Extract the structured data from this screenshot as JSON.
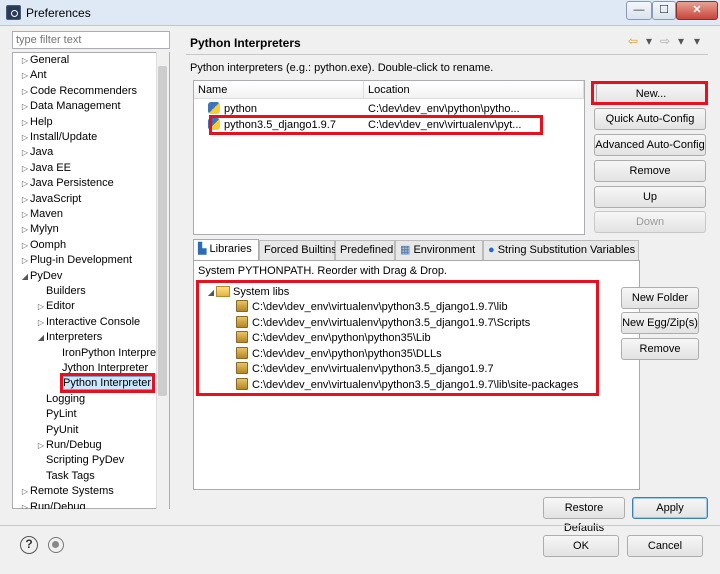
{
  "window": {
    "title": "Preferences",
    "minimize": "—",
    "maximize": "☐",
    "close": "✕"
  },
  "filter": {
    "placeholder": "type filter text"
  },
  "tree": [
    {
      "label": "General",
      "arrow": "▷"
    },
    {
      "label": "Ant",
      "arrow": "▷"
    },
    {
      "label": "Code Recommenders",
      "arrow": "▷"
    },
    {
      "label": "Data Management",
      "arrow": "▷"
    },
    {
      "label": "Help",
      "arrow": "▷"
    },
    {
      "label": "Install/Update",
      "arrow": "▷"
    },
    {
      "label": "Java",
      "arrow": "▷"
    },
    {
      "label": "Java EE",
      "arrow": "▷"
    },
    {
      "label": "Java Persistence",
      "arrow": "▷"
    },
    {
      "label": "JavaScript",
      "arrow": "▷"
    },
    {
      "label": "Maven",
      "arrow": "▷"
    },
    {
      "label": "Mylyn",
      "arrow": "▷"
    },
    {
      "label": "Oomph",
      "arrow": "▷"
    },
    {
      "label": "Plug-in Development",
      "arrow": "▷"
    },
    {
      "label": "PyDev",
      "arrow": "◢"
    },
    {
      "label": "Builders",
      "arrow": ""
    },
    {
      "label": "Editor",
      "arrow": "▷"
    },
    {
      "label": "Interactive Console",
      "arrow": "▷"
    },
    {
      "label": "Interpreters",
      "arrow": "◢"
    },
    {
      "label": "IronPython Interpreter",
      "arrow": ""
    },
    {
      "label": "Jython Interpreter",
      "arrow": ""
    },
    {
      "label": "Python Interpreter",
      "arrow": ""
    },
    {
      "label": "Logging",
      "arrow": ""
    },
    {
      "label": "PyLint",
      "arrow": ""
    },
    {
      "label": "PyUnit",
      "arrow": ""
    },
    {
      "label": "Run/Debug",
      "arrow": "▷"
    },
    {
      "label": "Scripting PyDev",
      "arrow": ""
    },
    {
      "label": "Task Tags",
      "arrow": ""
    },
    {
      "label": "Remote Systems",
      "arrow": "▷"
    },
    {
      "label": "Run/Debug",
      "arrow": "▷"
    }
  ],
  "page": {
    "title": "Python Interpreters",
    "description": "Python interpreters (e.g.: python.exe).   Double-click to rename.",
    "nav": {
      "back": "⇦",
      "back_menu": "▾",
      "forward": "⇨",
      "forward_menu": "▾",
      "view_menu": "▾"
    }
  },
  "interpreters": {
    "columns": [
      "Name",
      "Location"
    ],
    "rows": [
      {
        "name": "python",
        "location": "C:\\dev\\dev_env\\python\\pytho..."
      },
      {
        "name": "python3.5_django1.9.7",
        "location": "C:\\dev\\dev_env\\virtualenv\\pyt..."
      }
    ]
  },
  "buttons": {
    "new": "New...",
    "quick": "Quick Auto-Config",
    "advanced": "Advanced Auto-Config",
    "remove": "Remove",
    "up": "Up",
    "down": "Down"
  },
  "tabs": [
    "Libraries",
    "Forced Builtins",
    "Predefined",
    "Environment",
    "String Substitution Variables"
  ],
  "libraries": {
    "caption": "System PYTHONPATH.   Reorder with Drag & Drop.",
    "root": "System libs",
    "paths": [
      "C:\\dev\\dev_env\\virtualenv\\python3.5_django1.9.7\\lib",
      "C:\\dev\\dev_env\\virtualenv\\python3.5_django1.9.7\\Scripts",
      "C:\\dev\\dev_env\\python\\python35\\Lib",
      "C:\\dev\\dev_env\\python\\python35\\DLLs",
      "C:\\dev\\dev_env\\virtualenv\\python3.5_django1.9.7",
      "C:\\dev\\dev_env\\virtualenv\\python3.5_django1.9.7\\lib\\site-packages"
    ],
    "buttons": {
      "new_folder": "New Folder",
      "new_egg": "New Egg/Zip(s)",
      "remove": "Remove"
    }
  },
  "footer": {
    "restore": "Restore Defaults",
    "apply": "Apply",
    "ok": "OK",
    "cancel": "Cancel",
    "help_icon": "?"
  }
}
